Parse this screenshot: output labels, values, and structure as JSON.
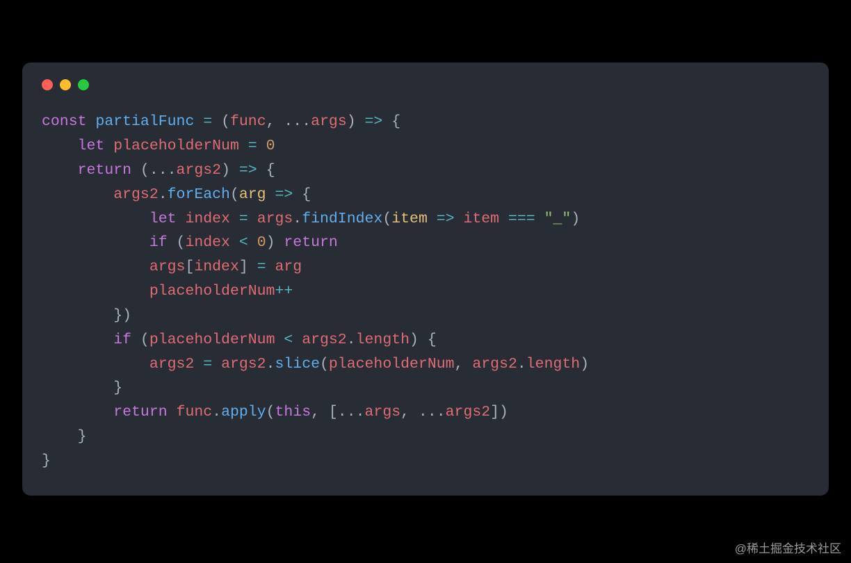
{
  "window": {
    "traffic_lights": [
      "close",
      "minimize",
      "zoom"
    ]
  },
  "watermark": "@稀土掘金技术社区",
  "colors": {
    "background_page": "#000000",
    "background_window": "#282c34",
    "default_text": "#abb2bf",
    "keyword": "#c678dd",
    "function": "#61afef",
    "variable": "#e06c75",
    "param": "#e5c07b",
    "number": "#d19a66",
    "string": "#98c379",
    "operator": "#56b6c2",
    "traffic_red": "#ff5f56",
    "traffic_yellow": "#ffbd2e",
    "traffic_green": "#27c93f"
  },
  "code": {
    "language": "javascript",
    "plain": "const partialFunc = (func, ...args) => {\n    let placeholderNum = 0\n    return (...args2) => {\n        args2.forEach(arg => {\n            let index = args.findIndex(item => item === \"_\")\n            if (index < 0) return\n            args[index] = arg\n            placeholderNum++\n        })\n        if (placeholderNum < args2.length) {\n            args2 = args2.slice(placeholderNum, args2.length)\n        }\n        return func.apply(this, [...args, ...args2])\n    }\n}",
    "tokens": [
      [
        [
          "kw",
          "const"
        ],
        [
          "punc",
          " "
        ],
        [
          "fn",
          "partialFunc"
        ],
        [
          "punc",
          " "
        ],
        [
          "op",
          "="
        ],
        [
          "punc",
          " ("
        ],
        [
          "var",
          "func"
        ],
        [
          "punc",
          ", ..."
        ],
        [
          "var",
          "args"
        ],
        [
          "punc",
          ") "
        ],
        [
          "op",
          "=>"
        ],
        [
          "punc",
          " {"
        ]
      ],
      [
        [
          "punc",
          "    "
        ],
        [
          "kw",
          "let"
        ],
        [
          "punc",
          " "
        ],
        [
          "var",
          "placeholderNum"
        ],
        [
          "punc",
          " "
        ],
        [
          "op",
          "="
        ],
        [
          "punc",
          " "
        ],
        [
          "num",
          "0"
        ]
      ],
      [
        [
          "punc",
          "    "
        ],
        [
          "kw",
          "return"
        ],
        [
          "punc",
          " (..."
        ],
        [
          "var",
          "args2"
        ],
        [
          "punc",
          ") "
        ],
        [
          "op",
          "=>"
        ],
        [
          "punc",
          " {"
        ]
      ],
      [
        [
          "punc",
          "        "
        ],
        [
          "var",
          "args2"
        ],
        [
          "punc",
          "."
        ],
        [
          "fn",
          "forEach"
        ],
        [
          "punc",
          "("
        ],
        [
          "param",
          "arg"
        ],
        [
          "punc",
          " "
        ],
        [
          "op",
          "=>"
        ],
        [
          "punc",
          " {"
        ]
      ],
      [
        [
          "punc",
          "            "
        ],
        [
          "kw",
          "let"
        ],
        [
          "punc",
          " "
        ],
        [
          "var",
          "index"
        ],
        [
          "punc",
          " "
        ],
        [
          "op",
          "="
        ],
        [
          "punc",
          " "
        ],
        [
          "var",
          "args"
        ],
        [
          "punc",
          "."
        ],
        [
          "fn",
          "findIndex"
        ],
        [
          "punc",
          "("
        ],
        [
          "param",
          "item"
        ],
        [
          "punc",
          " "
        ],
        [
          "op",
          "=>"
        ],
        [
          "punc",
          " "
        ],
        [
          "var",
          "item"
        ],
        [
          "punc",
          " "
        ],
        [
          "op",
          "==="
        ],
        [
          "punc",
          " "
        ],
        [
          "str",
          "\"_\""
        ],
        [
          "punc",
          ")"
        ]
      ],
      [
        [
          "punc",
          "            "
        ],
        [
          "kw",
          "if"
        ],
        [
          "punc",
          " ("
        ],
        [
          "var",
          "index"
        ],
        [
          "punc",
          " "
        ],
        [
          "op",
          "<"
        ],
        [
          "punc",
          " "
        ],
        [
          "num",
          "0"
        ],
        [
          "punc",
          ") "
        ],
        [
          "kw",
          "return"
        ]
      ],
      [
        [
          "punc",
          "            "
        ],
        [
          "var",
          "args"
        ],
        [
          "punc",
          "["
        ],
        [
          "var",
          "index"
        ],
        [
          "punc",
          "] "
        ],
        [
          "op",
          "="
        ],
        [
          "punc",
          " "
        ],
        [
          "var",
          "arg"
        ]
      ],
      [
        [
          "punc",
          "            "
        ],
        [
          "var",
          "placeholderNum"
        ],
        [
          "op",
          "++"
        ]
      ],
      [
        [
          "punc",
          "        })"
        ]
      ],
      [
        [
          "punc",
          "        "
        ],
        [
          "kw",
          "if"
        ],
        [
          "punc",
          " ("
        ],
        [
          "var",
          "placeholderNum"
        ],
        [
          "punc",
          " "
        ],
        [
          "op",
          "<"
        ],
        [
          "punc",
          " "
        ],
        [
          "var",
          "args2"
        ],
        [
          "punc",
          "."
        ],
        [
          "var",
          "length"
        ],
        [
          "punc",
          ") {"
        ]
      ],
      [
        [
          "punc",
          "            "
        ],
        [
          "var",
          "args2"
        ],
        [
          "punc",
          " "
        ],
        [
          "op",
          "="
        ],
        [
          "punc",
          " "
        ],
        [
          "var",
          "args2"
        ],
        [
          "punc",
          "."
        ],
        [
          "fn",
          "slice"
        ],
        [
          "punc",
          "("
        ],
        [
          "var",
          "placeholderNum"
        ],
        [
          "punc",
          ", "
        ],
        [
          "var",
          "args2"
        ],
        [
          "punc",
          "."
        ],
        [
          "var",
          "length"
        ],
        [
          "punc",
          ")"
        ]
      ],
      [
        [
          "punc",
          "        }"
        ]
      ],
      [
        [
          "punc",
          "        "
        ],
        [
          "kw",
          "return"
        ],
        [
          "punc",
          " "
        ],
        [
          "var",
          "func"
        ],
        [
          "punc",
          "."
        ],
        [
          "fn",
          "apply"
        ],
        [
          "punc",
          "("
        ],
        [
          "kw",
          "this"
        ],
        [
          "punc",
          ", [..."
        ],
        [
          "var",
          "args"
        ],
        [
          "punc",
          ", ..."
        ],
        [
          "var",
          "args2"
        ],
        [
          "punc",
          "])"
        ]
      ],
      [
        [
          "punc",
          "    }"
        ]
      ],
      [
        [
          "punc",
          "}"
        ]
      ]
    ]
  }
}
